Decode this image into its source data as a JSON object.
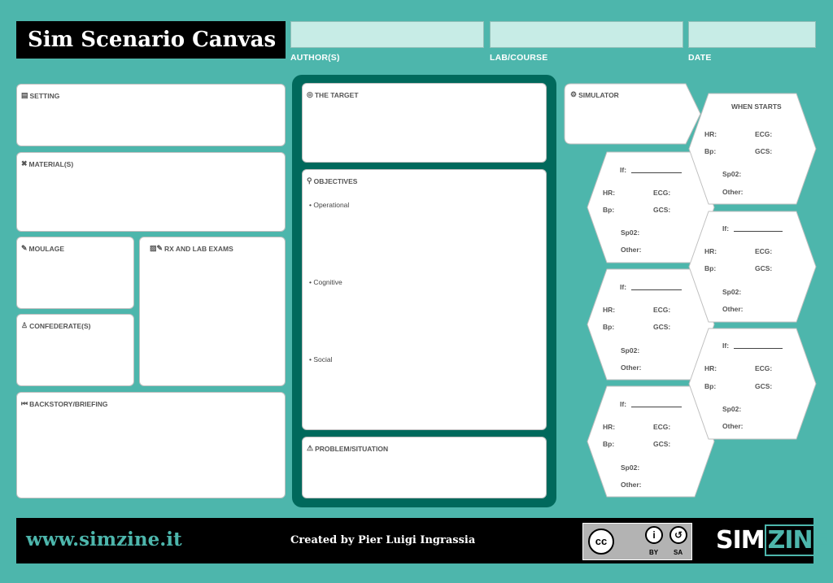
{
  "header": {
    "title": "Sim Scenario Canvas",
    "fields": [
      {
        "label": "AUTHOR(S)",
        "value": ""
      },
      {
        "label": "LAB/COURSE",
        "value": ""
      },
      {
        "label": "DATE",
        "value": ""
      }
    ]
  },
  "left": {
    "setting": "SETTING",
    "materials": "MATERIAL(S)",
    "moulage": "MOULAGE",
    "rx": "RX AND LAB EXAMS",
    "confederate": "CONFEDERATE(S)",
    "backstory": "BACKSTORY/BRIEFING"
  },
  "center": {
    "target": "THE TARGET",
    "objectives": {
      "label": "OBJECTIVES",
      "items": [
        "• Operational",
        "• Cognitive",
        "• Social"
      ]
    },
    "problem": "PROBLEM/SITUATION"
  },
  "right": {
    "simulator": "SIMULATOR",
    "start_hex": {
      "title": "WHEN STARTS",
      "hr": "HR:",
      "ecg": "ECG:",
      "bp": "Bp:",
      "gcs": "GCS:",
      "spo2": "Sp02:",
      "other": "Other:"
    },
    "hex": {
      "if": "If:",
      "hr": "HR:",
      "ecg": "ECG:",
      "bp": "Bp:",
      "gcs": "GCS:",
      "spo2": "Sp02:",
      "other": "Other:"
    }
  },
  "footer": {
    "site": "www.simzine.it",
    "credit": "Created by Pier Luigi Ingrassia",
    "license": {
      "cc": "cc",
      "by": "BY",
      "sa": "SA"
    },
    "brand_sim": "SIM",
    "brand_zine": "ZINE"
  },
  "colors": {
    "background": "#4db6ac",
    "center_frame": "#00695c",
    "input_fill": "#c7ece6",
    "footer": "#000000"
  },
  "icons": [
    "list-icon",
    "tools-icon",
    "brush-icon",
    "image-edit-icon",
    "user-icon",
    "fast-backward-icon",
    "target-icon",
    "map-pin-icon",
    "warning-icon",
    "gears-icon",
    "cc-icon",
    "by-icon",
    "sa-icon"
  ]
}
